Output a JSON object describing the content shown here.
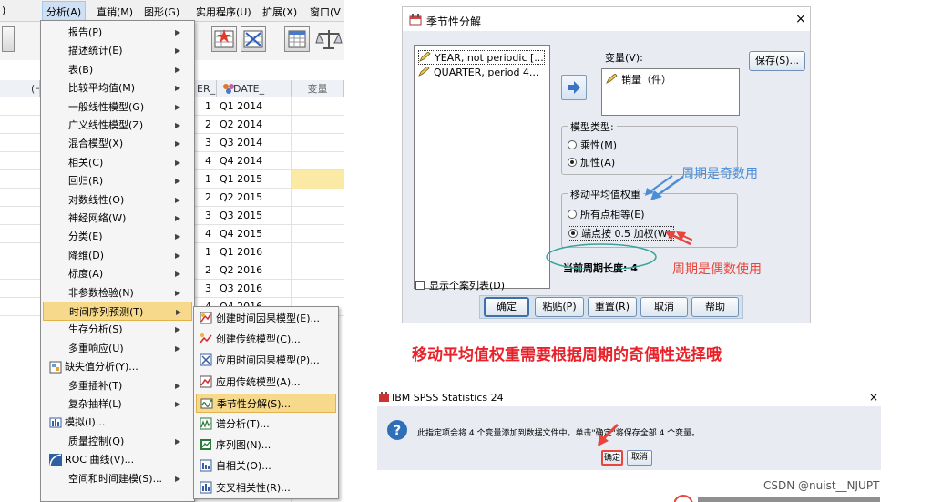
{
  "menubar": {
    "items": [
      {
        "label": ")"
      },
      {
        "label": "分析(A)"
      },
      {
        "label": "直销(M)"
      },
      {
        "label": "图形(G)"
      },
      {
        "label": "实用程序(U)"
      },
      {
        "label": "扩展(X)"
      },
      {
        "label": "窗口(V"
      }
    ],
    "active_index": 1
  },
  "grid": {
    "headers": [
      "(⊦",
      "ER_",
      "DATE_",
      "变量"
    ],
    "rows": [
      {
        "n": "1",
        "date": "Q1 2014"
      },
      {
        "n": "2",
        "date": "Q2 2014"
      },
      {
        "n": "3",
        "date": "Q3 2014"
      },
      {
        "n": "4",
        "date": "Q4 2014"
      },
      {
        "n": "1",
        "date": "Q1 2015"
      },
      {
        "n": "2",
        "date": "Q2 2015"
      },
      {
        "n": "3",
        "date": "Q3 2015"
      },
      {
        "n": "4",
        "date": "Q4 2015"
      },
      {
        "n": "1",
        "date": "Q1 2016"
      },
      {
        "n": "2",
        "date": "Q2 2016"
      },
      {
        "n": "3",
        "date": "Q3 2016"
      },
      {
        "n": "4",
        "date": "Q4 2016"
      }
    ],
    "highlight_row": 4,
    "highlight_color": "#fbe9a6"
  },
  "analyze_menu": {
    "items": [
      {
        "label": "报告(P)",
        "submenu": true
      },
      {
        "label": "描述统计(E)",
        "submenu": true
      },
      {
        "label": "表(B)",
        "submenu": true
      },
      {
        "label": "比较平均值(M)",
        "submenu": true
      },
      {
        "label": "一般线性模型(G)",
        "submenu": true
      },
      {
        "label": "广义线性模型(Z)",
        "submenu": true
      },
      {
        "label": "混合模型(X)",
        "submenu": true
      },
      {
        "label": "相关(C)",
        "submenu": true
      },
      {
        "label": "回归(R)",
        "submenu": true
      },
      {
        "label": "对数线性(O)",
        "submenu": true
      },
      {
        "label": "神经网络(W)",
        "submenu": true
      },
      {
        "label": "分类(E)",
        "submenu": true
      },
      {
        "label": "降维(D)",
        "submenu": true
      },
      {
        "label": "标度(A)",
        "submenu": true
      },
      {
        "label": "非参数检验(N)",
        "submenu": true
      },
      {
        "label": "时间序列预测(T)",
        "submenu": true,
        "selected": true
      },
      {
        "label": "生存分析(S)",
        "submenu": true
      },
      {
        "label": "多重响应(U)",
        "submenu": true
      },
      {
        "label": "缺失值分析(Y)...",
        "submenu": false,
        "icon": "missing-values-icon"
      },
      {
        "label": "多重插补(T)",
        "submenu": true
      },
      {
        "label": "复杂抽样(L)",
        "submenu": true
      },
      {
        "label": "模拟(I)...",
        "submenu": false,
        "icon": "simulation-icon"
      },
      {
        "label": "质量控制(Q)",
        "submenu": true
      },
      {
        "label": "ROC 曲线(V)...",
        "submenu": false,
        "icon": "roc-curve-icon"
      },
      {
        "label": "空间和时间建模(S)...",
        "submenu": true
      }
    ]
  },
  "forecast_submenu": {
    "items": [
      {
        "label": "创建时间因果模型(E)...",
        "icon": "temporal-causal-icon"
      },
      {
        "label": "创建传统模型(C)...",
        "icon": "traditional-model-icon"
      },
      {
        "label": "应用时间因果模型(P)...",
        "icon": "apply-causal-icon"
      },
      {
        "label": "应用传统模型(A)...",
        "icon": "apply-traditional-icon"
      },
      {
        "label": "季节性分解(S)...",
        "icon": "seasonal-decomp-icon",
        "selected": true
      },
      {
        "label": "谱分析(T)...",
        "icon": "spectral-icon"
      },
      {
        "label": "序列图(N)...",
        "icon": "sequence-chart-icon"
      },
      {
        "label": "自相关(O)...",
        "icon": "autocorrelation-icon"
      },
      {
        "label": "交叉相关性(R)...",
        "icon": "cross-correlation-icon"
      }
    ]
  },
  "seasonal_dialog": {
    "title": "季节性分解",
    "close": "×",
    "source_vars": [
      "YEAR, not periodic [...",
      "QUARTER, period 4..."
    ],
    "variables_label": "变量(V):",
    "target_vars": [
      "销量（件）"
    ],
    "save_button": "保存(S)...",
    "model_type": {
      "title": "模型类型:",
      "options": [
        {
          "label": "乘性(M)",
          "checked": false
        },
        {
          "label": "加性(A)",
          "checked": true
        }
      ]
    },
    "moving_avg": {
      "title": "移动平均值权重",
      "options": [
        {
          "label": "所有点相等(E)",
          "checked": false
        },
        {
          "label": "端点按 0.5 加权(W)",
          "checked": true
        }
      ]
    },
    "period_label": "当前周期长度: 4",
    "show_casewise": "显示个案列表(D)",
    "buttons": {
      "ok": "确定",
      "paste": "粘贴(P)",
      "reset": "重置(R)",
      "cancel": "取消",
      "help": "帮助"
    }
  },
  "annotations": {
    "odd": "周期是奇数用",
    "even": "周期是偶数使用",
    "caption": "移动平均值权重需要根据周期的奇偶性选择哦"
  },
  "confirm_dialog": {
    "title": "IBM SPSS Statistics 24",
    "close": "×",
    "message": "此指定项会将 4 个变量添加到数据文件中。单击\"确定\"将保存全部 4 个变量。",
    "ok": "确定",
    "cancel": "取消"
  },
  "watermark": "CSDN @nuist__NJUPT",
  "colors": {
    "menu_selected": "#f6d98a",
    "annotation_red": "#e8453c",
    "annotation_blue": "#4b8ed8",
    "caption_red": "#e8222a"
  }
}
